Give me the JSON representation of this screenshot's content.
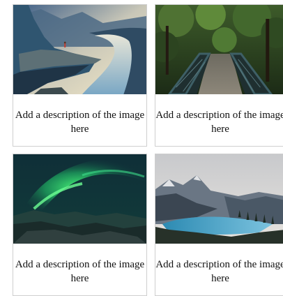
{
  "cards": [
    {
      "description": "Add a description of the image here",
      "image": "fjord-cliff-landscape-photo"
    },
    {
      "description": "Add a description of the image here",
      "image": "forest-bridge-photo"
    },
    {
      "description": "Add a description of the image here",
      "image": "aurora-borealis-photo"
    },
    {
      "description": "Add a description of the image here",
      "image": "mountain-lake-photo"
    }
  ]
}
